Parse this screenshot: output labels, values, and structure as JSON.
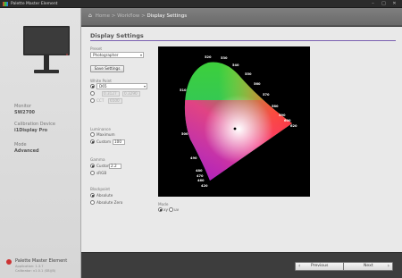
{
  "window": {
    "title": "Palette Master Element",
    "minimize": "–",
    "maximize": "□",
    "close": "✕"
  },
  "breadcrumb": {
    "home": "Home",
    "sep1": ">",
    "workflow": "Workflow",
    "sep2": ">",
    "current": "Display Settings"
  },
  "sidebar": {
    "monitor_label": "Monitor",
    "monitor_value": "SW2700",
    "device_label": "Calibration Device",
    "device_value": "i1Display Pro",
    "mode_label": "Mode",
    "mode_value": "Advanced",
    "footer_title": "Palette Master Element",
    "footer_line1": "Application: 1.3.7",
    "footer_line2": "Calibrator: v1.0.1 (SB)(B)"
  },
  "page": {
    "title": "Display Settings",
    "preset_label": "Preset",
    "preset_value": "Photographer",
    "save_button": "Save Settings",
    "white_point_label": "White Point",
    "white_point_value": "D65",
    "white_x_value": "0.3127",
    "white_y_value": "0.3290",
    "cct_label": "CCT",
    "cct_value": "6500",
    "luminance_label": "Luminance",
    "luminance_opt1": "Maximum",
    "luminance_opt2": "Custom",
    "luminance_value": "100",
    "gamma_label": "Gamma",
    "gamma_opt1": "Custom",
    "gamma_value": "2.2",
    "gamma_opt2": "sRGB",
    "blackpoint_label": "Blackpoint",
    "blackpoint_opt1": "Absolute",
    "blackpoint_opt2": "Absolute Zero",
    "mode_label": "Mode",
    "mode_opt1": "xy",
    "mode_opt2": "uv",
    "wavelengths": [
      "520",
      "530",
      "540",
      "550",
      "560",
      "570",
      "580",
      "590",
      "600",
      "620",
      "510",
      "500",
      "490",
      "480",
      "470",
      "460",
      "420"
    ]
  },
  "footer": {
    "previous": "Previous",
    "next": "Next",
    "prev_arrow": "‹",
    "next_arrow": "›"
  },
  "colors": {
    "accent": "#7a5fb0",
    "header": "#757575",
    "panel": "#e9e9e9"
  }
}
